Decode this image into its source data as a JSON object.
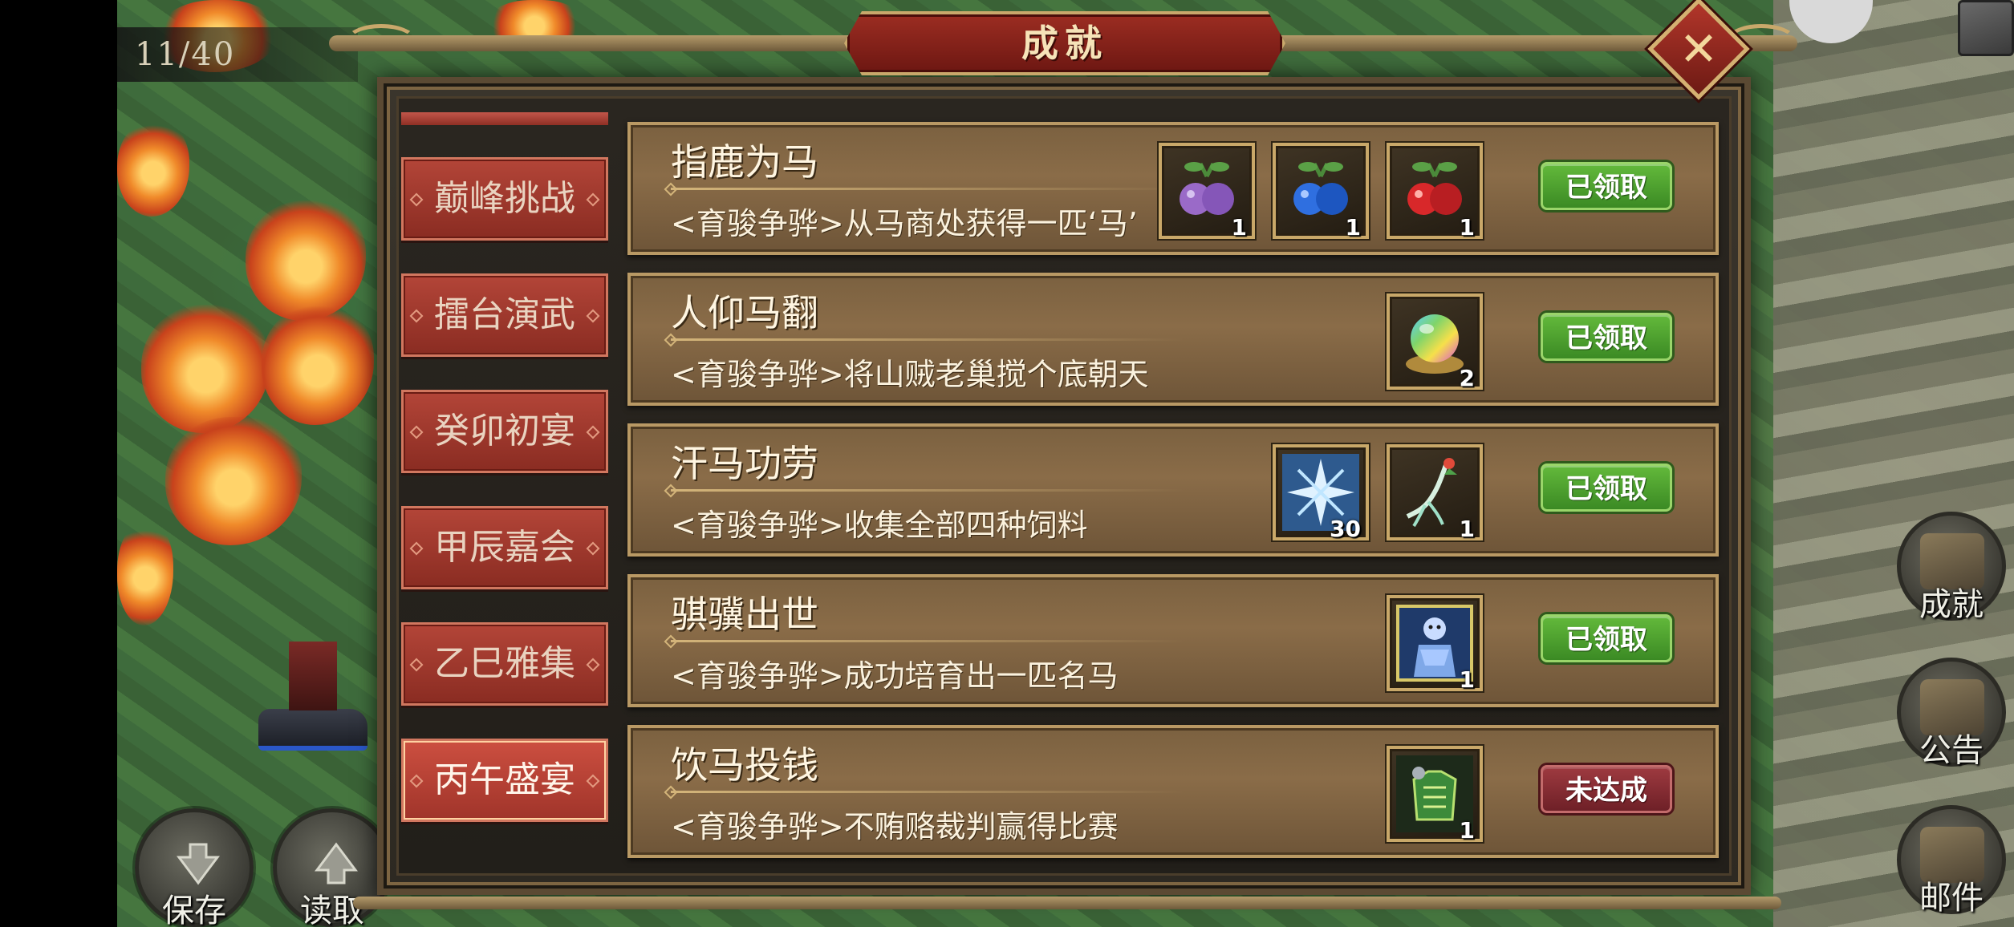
{
  "hud": {
    "page_counter": "11/40",
    "left_buttons": [
      {
        "label": "保存",
        "icon": "save-arrow-down-icon"
      },
      {
        "label": "读取",
        "icon": "load-arrow-up-icon"
      }
    ],
    "right_buttons": [
      {
        "label": "成就",
        "icon": "achievement-icon"
      },
      {
        "label": "公告",
        "icon": "notice-scroll-icon"
      },
      {
        "label": "邮件",
        "icon": "mail-icon"
      }
    ]
  },
  "dialog": {
    "title": "成就",
    "close_icon": "close-x-icon",
    "close_glyph": "✕",
    "tabs": [
      {
        "label": "巅峰挑战",
        "active": false
      },
      {
        "label": "擂台演武",
        "active": false
      },
      {
        "label": "癸卯初宴",
        "active": false
      },
      {
        "label": "甲辰嘉会",
        "active": false
      },
      {
        "label": "乙巳雅集",
        "active": false
      },
      {
        "label": "丙午盛宴",
        "active": true
      }
    ],
    "achievements": [
      {
        "title": "指鹿为马",
        "description": "<育骏争骅>从马商处获得一匹‘马’",
        "status": "已领取",
        "state": "claimed",
        "rewards": [
          {
            "icon": "purple-berry-icon",
            "count": "1",
            "color": "#9a6ac8"
          },
          {
            "icon": "blue-berry-icon",
            "count": "1",
            "color": "#2f6fe0"
          },
          {
            "icon": "red-berry-icon",
            "count": "1",
            "color": "#d8282a"
          }
        ]
      },
      {
        "title": "人仰马翻",
        "description": "<育骏争骅>将山贼老巢搅个底朝天",
        "status": "已领取",
        "state": "claimed",
        "rewards": [
          {
            "icon": "rainbow-orb-icon",
            "count": "2",
            "color": "#7fd46a"
          }
        ]
      },
      {
        "title": "汗马功劳",
        "description": "<育骏争骅>收集全部四种饲料",
        "status": "已领取",
        "state": "claimed",
        "rewards": [
          {
            "icon": "ice-crystal-icon",
            "count": "30",
            "color": "#bfe6ff"
          },
          {
            "icon": "ginseng-icon",
            "count": "1",
            "color": "#9fe0c8"
          }
        ]
      },
      {
        "title": "骐骥出世",
        "description": "<育骏争骅>成功培育出一匹名马",
        "status": "已领取",
        "state": "claimed",
        "rewards": [
          {
            "icon": "armored-warrior-portrait-icon",
            "count": "1",
            "color": "#4a78c8"
          }
        ]
      },
      {
        "title": "饮马投钱",
        "description": "<育骏争骅>不贿赂裁判赢得比赛",
        "status": "未达成",
        "state": "unmet",
        "rewards": [
          {
            "icon": "green-armor-icon",
            "count": "1",
            "color": "#3c8a3a"
          }
        ]
      }
    ]
  }
}
